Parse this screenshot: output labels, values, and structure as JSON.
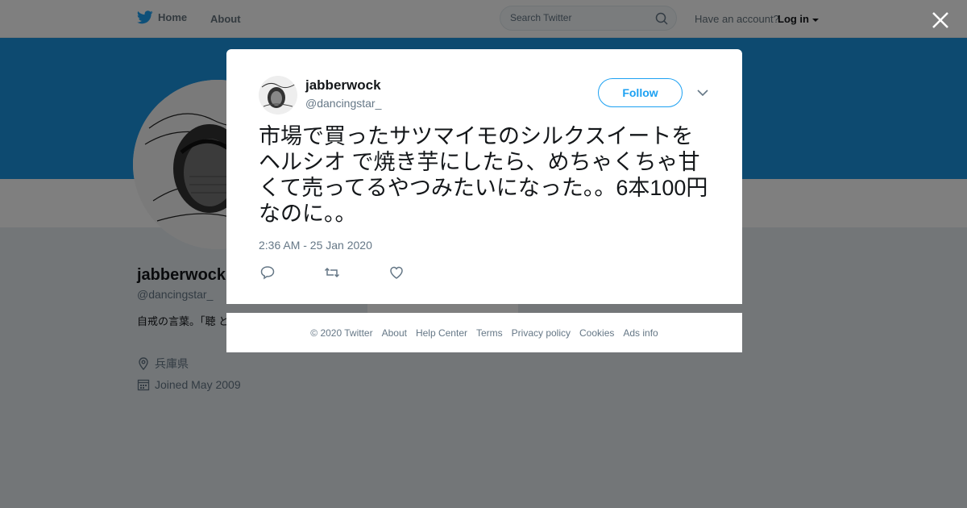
{
  "topbar": {
    "home_label": "Home",
    "about_label": "About",
    "search_placeholder": "Search Twitter",
    "account_prompt": "Have an account?",
    "login_label": "Log in"
  },
  "profile": {
    "name": "jabberwock",
    "handle": "@dancingstar_",
    "bio": "自戒の言葉。「聴 とを少なくし,行う",
    "location": "兵庫県",
    "joined": "Joined May 2009"
  },
  "tweet": {
    "name": "jabberwock",
    "handle": "@dancingstar_",
    "follow_label": "Follow",
    "text": "市場で買ったサツマイモのシルクスイートをヘルシオ で焼き芋にしたら、めちゃくちゃ甘くて売ってるやつみたいになった。。6本100円なのに。。",
    "timestamp": "2:36 AM - 25 Jan 2020"
  },
  "footer": {
    "links": [
      "© 2020 Twitter",
      "About",
      "Help Center",
      "Terms",
      "Privacy policy",
      "Cookies",
      "Ads info"
    ]
  },
  "colors": {
    "brand_blue": "#1da1f2",
    "banner": "#1b95e0",
    "text_secondary": "#657786"
  },
  "icons": [
    "twitter-bird-icon",
    "search-icon",
    "caret-down-icon",
    "close-icon",
    "chevron-down-icon",
    "reply-icon",
    "retweet-icon",
    "like-icon",
    "location-icon",
    "calendar-icon"
  ]
}
